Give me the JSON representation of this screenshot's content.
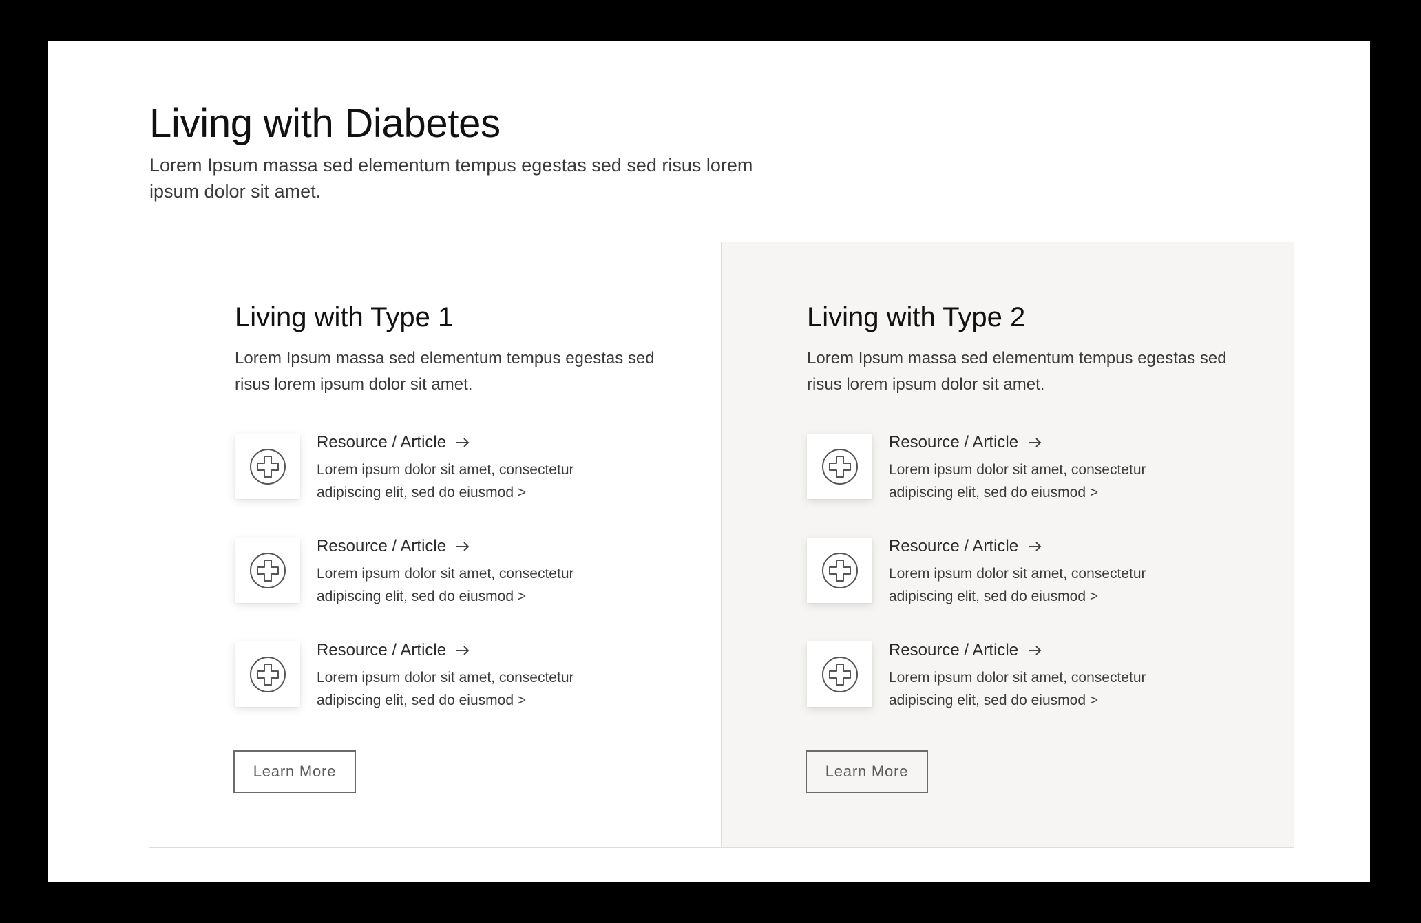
{
  "page": {
    "title": "Living with Diabetes",
    "intro": "Lorem Ipsum massa sed elementum tempus egestas sed sed risus lorem ipsum dolor sit amet."
  },
  "cards": [
    {
      "title": "Living with Type 1",
      "description": "Lorem Ipsum massa sed elementum tempus egestas sed risus lorem ipsum dolor sit amet.",
      "resources": [
        {
          "icon": "medical-cross-icon",
          "title": "Resource / Article",
          "description": "Lorem ipsum dolor sit amet, consectetur adipiscing elit, sed do eiusmod >"
        },
        {
          "icon": "medical-cross-icon",
          "title": "Resource / Article",
          "description": "Lorem ipsum dolor sit amet, consectetur adipiscing elit, sed do eiusmod >"
        },
        {
          "icon": "medical-cross-icon",
          "title": "Resource / Article",
          "description": "Lorem ipsum dolor sit amet, consectetur adipiscing elit, sed do eiusmod >"
        }
      ],
      "button_label": "Learn More",
      "background": "#ffffff"
    },
    {
      "title": "Living with Type 2",
      "description": "Lorem Ipsum massa sed elementum tempus egestas sed risus lorem ipsum dolor sit amet.",
      "resources": [
        {
          "icon": "medical-cross-icon",
          "title": "Resource / Article",
          "description": "Lorem ipsum dolor sit amet, consectetur adipiscing elit, sed do eiusmod >"
        },
        {
          "icon": "medical-cross-icon",
          "title": "Resource / Article",
          "description": "Lorem ipsum dolor sit amet, consectetur adipiscing elit, sed do eiusmod >"
        },
        {
          "icon": "medical-cross-icon",
          "title": "Resource / Article",
          "description": "Lorem ipsum dolor sit amet, consectetur adipiscing elit, sed do eiusmod >"
        }
      ],
      "button_label": "Learn More",
      "background": "#f6f5f3"
    }
  ],
  "colors": {
    "frame": "#000000",
    "text_primary": "#111111",
    "text_secondary": "#3a3a3a",
    "border": "#dcdcdc",
    "button_border": "#6b6b6b"
  }
}
